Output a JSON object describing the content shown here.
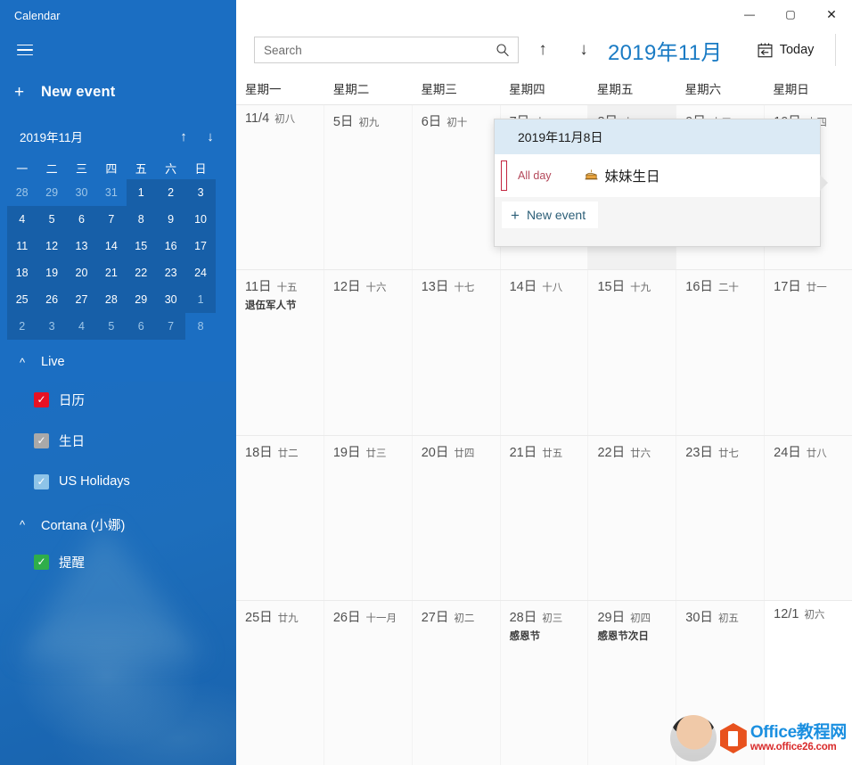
{
  "app": {
    "title": "Calendar"
  },
  "sidebar": {
    "menu_icon": "hamburger-icon",
    "new_event": {
      "plus": "+",
      "label": "New event"
    },
    "mini": {
      "title": "2019年11月",
      "prev_arrow": "↑",
      "next_arrow": "↓",
      "dow": [
        "一",
        "二",
        "三",
        "四",
        "五",
        "六",
        "日"
      ],
      "weeks": [
        [
          {
            "d": "28",
            "m": "other"
          },
          {
            "d": "29",
            "m": "other"
          },
          {
            "d": "30",
            "m": "other"
          },
          {
            "d": "31",
            "m": "other"
          },
          {
            "d": "1",
            "m": "cur"
          },
          {
            "d": "2",
            "m": "cur"
          },
          {
            "d": "3",
            "m": "cur"
          }
        ],
        [
          {
            "d": "4",
            "m": "cur"
          },
          {
            "d": "5",
            "m": "cur"
          },
          {
            "d": "6",
            "m": "cur"
          },
          {
            "d": "7",
            "m": "cur"
          },
          {
            "d": "8",
            "m": "cur"
          },
          {
            "d": "9",
            "m": "cur"
          },
          {
            "d": "10",
            "m": "cur"
          }
        ],
        [
          {
            "d": "11",
            "m": "cur"
          },
          {
            "d": "12",
            "m": "cur"
          },
          {
            "d": "13",
            "m": "cur"
          },
          {
            "d": "14",
            "m": "cur"
          },
          {
            "d": "15",
            "m": "cur"
          },
          {
            "d": "16",
            "m": "cur"
          },
          {
            "d": "17",
            "m": "cur"
          }
        ],
        [
          {
            "d": "18",
            "m": "cur"
          },
          {
            "d": "19",
            "m": "cur"
          },
          {
            "d": "20",
            "m": "cur"
          },
          {
            "d": "21",
            "m": "cur"
          },
          {
            "d": "22",
            "m": "cur"
          },
          {
            "d": "23",
            "m": "cur"
          },
          {
            "d": "24",
            "m": "cur"
          }
        ],
        [
          {
            "d": "25",
            "m": "cur"
          },
          {
            "d": "26",
            "m": "cur"
          },
          {
            "d": "27",
            "m": "cur"
          },
          {
            "d": "28",
            "m": "cur"
          },
          {
            "d": "29",
            "m": "cur"
          },
          {
            "d": "30",
            "m": "cur"
          },
          {
            "d": "1",
            "m": "other"
          }
        ],
        [
          {
            "d": "2",
            "m": "other"
          },
          {
            "d": "3",
            "m": "other"
          },
          {
            "d": "4",
            "m": "other"
          },
          {
            "d": "5",
            "m": "other"
          },
          {
            "d": "6",
            "m": "other"
          },
          {
            "d": "7",
            "m": "other"
          },
          {
            "d": "8",
            "m": "other"
          }
        ]
      ]
    },
    "groups": [
      {
        "name": "Live",
        "chevron": "chevron-up-icon",
        "calendars": [
          {
            "name": "日历",
            "checked": true,
            "color": "#e81123"
          },
          {
            "name": "生日",
            "checked": true,
            "color": "#a9a9a9"
          },
          {
            "name": "US Holidays",
            "checked": true,
            "color": "#8ec4e8"
          }
        ]
      },
      {
        "name": "Cortana (小娜)",
        "chevron": "chevron-up-icon",
        "calendars": [
          {
            "name": "提醒",
            "checked": true,
            "color": "#2fae4a"
          }
        ]
      }
    ]
  },
  "window_controls": {
    "minimize": "—",
    "maximize": "▢",
    "close": "✕"
  },
  "toolbar": {
    "search": {
      "value": "",
      "placeholder": "Search",
      "icon": "search-icon"
    },
    "prev_arrow": "↑",
    "next_arrow": "↓",
    "month_title": "2019年11月",
    "today": {
      "label": "Today",
      "icon": "today-calendar-icon"
    }
  },
  "grid": {
    "dow_headers": [
      "星期一",
      "星期二",
      "星期三",
      "星期四",
      "星期五",
      "星期六",
      "星期日"
    ],
    "weeks": [
      [
        {
          "day": "11/4",
          "lunar": "初八",
          "state": "in"
        },
        {
          "day": "5日",
          "lunar": "初九",
          "state": "in"
        },
        {
          "day": "6日",
          "lunar": "初十",
          "state": "in"
        },
        {
          "day": "7日",
          "lunar": "十一",
          "state": "in"
        },
        {
          "day": "8日",
          "lunar": "十二",
          "state": "selected",
          "birthday": "妹妹生日"
        },
        {
          "day": "9日",
          "lunar": "十三",
          "state": "in"
        },
        {
          "day": "10日",
          "lunar": "十四",
          "state": "in"
        }
      ],
      [
        {
          "day": "11日",
          "lunar": "十五",
          "state": "in",
          "event": "退伍军人节"
        },
        {
          "day": "12日",
          "lunar": "十六",
          "state": "in"
        },
        {
          "day": "13日",
          "lunar": "十七",
          "state": "in"
        },
        {
          "day": "14日",
          "lunar": "十八",
          "state": "in"
        },
        {
          "day": "15日",
          "lunar": "十九",
          "state": "in"
        },
        {
          "day": "16日",
          "lunar": "二十",
          "state": "in"
        },
        {
          "day": "17日",
          "lunar": "廿一",
          "state": "in"
        }
      ],
      [
        {
          "day": "18日",
          "lunar": "廿二",
          "state": "in"
        },
        {
          "day": "19日",
          "lunar": "廿三",
          "state": "in"
        },
        {
          "day": "20日",
          "lunar": "廿四",
          "state": "in"
        },
        {
          "day": "21日",
          "lunar": "廿五",
          "state": "in"
        },
        {
          "day": "22日",
          "lunar": "廿六",
          "state": "in"
        },
        {
          "day": "23日",
          "lunar": "廿七",
          "state": "in"
        },
        {
          "day": "24日",
          "lunar": "廿八",
          "state": "in"
        }
      ],
      [
        {
          "day": "25日",
          "lunar": "廿九",
          "state": "in"
        },
        {
          "day": "26日",
          "lunar": "十一月",
          "state": "in"
        },
        {
          "day": "27日",
          "lunar": "初二",
          "state": "in"
        },
        {
          "day": "28日",
          "lunar": "初三",
          "state": "in",
          "event": "感恩节"
        },
        {
          "day": "29日",
          "lunar": "初四",
          "state": "in",
          "event": "感恩节次日"
        },
        {
          "day": "30日",
          "lunar": "初五",
          "state": "in"
        },
        {
          "day": "12/1",
          "lunar": "初六",
          "state": "outside"
        }
      ]
    ]
  },
  "flyout": {
    "date_title": "2019年11月8日",
    "all_day_label": "All day",
    "event_title": "妹妹生日",
    "event_icon": "birthday-cake-icon",
    "new_event": {
      "plus": "+",
      "label": "New event"
    }
  },
  "watermark": {
    "main": "Office教程网",
    "sub": "www.office26.com"
  }
}
